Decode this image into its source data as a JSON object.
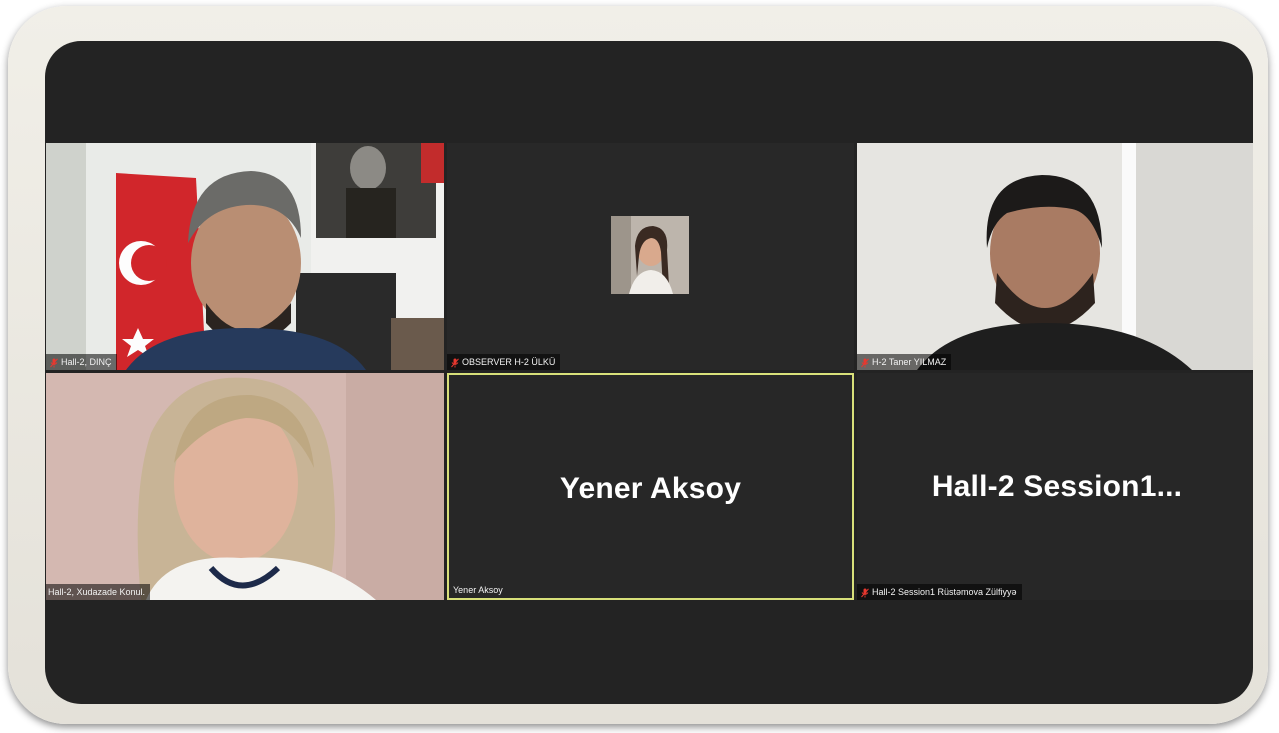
{
  "participants": [
    {
      "name": "Hall-2, DINÇ",
      "muted": true
    },
    {
      "name": "OBSERVER H-2 ÜLKÜ",
      "muted": true
    },
    {
      "name": "H-2  Taner YILMAZ",
      "muted": true
    },
    {
      "name": "Hall-2, Xudazade Konul.",
      "muted": false
    },
    {
      "name": "Yener Aksoy",
      "muted": false,
      "display_name": "Yener Aksoy",
      "active_speaker": true
    },
    {
      "name": "Hall-2 Session1 Rüstəmova Zülfiyyə",
      "muted": true,
      "display_name": "Hall-2  Session1..."
    }
  ],
  "colors": {
    "active_speaker_border": "#d8e07a",
    "mute_icon": "#e8382f",
    "tile_background": "#272727",
    "screen_background": "#232323"
  },
  "icons": [
    "muted-microphone-icon"
  ]
}
